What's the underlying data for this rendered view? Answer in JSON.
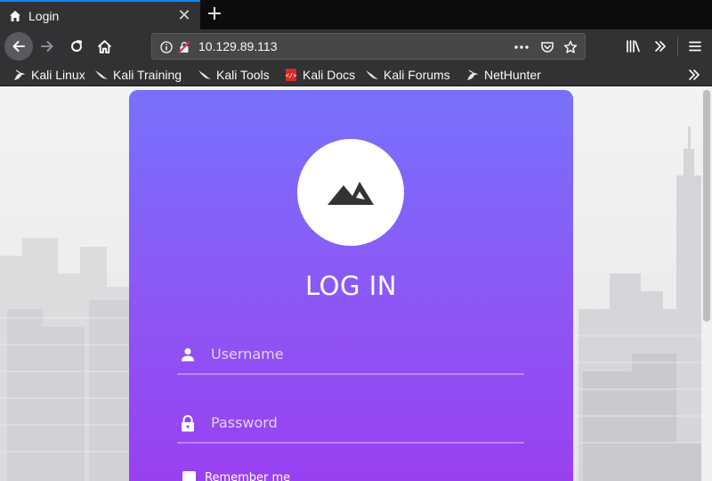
{
  "browser": {
    "tab": {
      "title": "Login",
      "favicon": "home-icon"
    },
    "url": "10.129.89.113",
    "bookmarks": [
      {
        "label": "Kali Linux",
        "icon": "kali-dragon-icon"
      },
      {
        "label": "Kali Training",
        "icon": "kali-dragon-icon"
      },
      {
        "label": "Kali Tools",
        "icon": "kali-dragon-icon"
      },
      {
        "label": "Kali Docs",
        "icon": "kali-docs-icon"
      },
      {
        "label": "Kali Forums",
        "icon": "kali-dragon-icon"
      },
      {
        "label": "NetHunter",
        "icon": "kali-dragon-icon"
      }
    ],
    "colors": {
      "chrome": "#323234",
      "tabstrip": "#0c0c0d",
      "active_tab_accent": "#0a84ff"
    }
  },
  "page": {
    "title": "LOG IN",
    "logo_icon": "mountains-icon",
    "username_placeholder": "Username",
    "password_placeholder": "Password",
    "remember_label": "Remember me",
    "colors": {
      "card_top": "#7871fd",
      "card_bottom": "#9a3ef0"
    }
  }
}
